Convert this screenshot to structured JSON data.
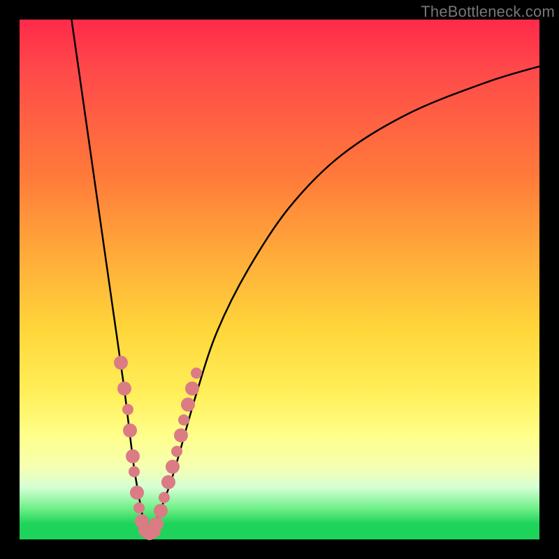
{
  "watermark": "TheBottleneck.com",
  "colors": {
    "border": "#000000",
    "curve": "#000000",
    "bead": "#db7b84",
    "gradient_top": "#ff2a4a",
    "gradient_mid": "#ffef5a",
    "gradient_bottom": "#1ed35a"
  },
  "plot": {
    "inner_size_px": 744,
    "border_px": 28
  },
  "chart_data": {
    "type": "line",
    "title": "",
    "xlabel": "",
    "ylabel": "",
    "xlim": [
      0,
      100
    ],
    "ylim": [
      0,
      100
    ],
    "series": [
      {
        "name": "bottleneck_curve",
        "x": [
          10,
          12,
          14,
          16,
          18,
          20,
          21,
          22,
          23,
          24,
          25,
          26,
          28,
          30,
          34,
          38,
          44,
          52,
          62,
          75,
          90,
          100
        ],
        "y": [
          100,
          86,
          72,
          58,
          44,
          30,
          22,
          14,
          8,
          3,
          1,
          3,
          8,
          14,
          28,
          40,
          52,
          64,
          74,
          82,
          88,
          91
        ]
      }
    ],
    "markers": {
      "name": "beads",
      "comment": "clustered points along lower curve near minimum",
      "points": [
        {
          "x": 19.5,
          "y": 34,
          "r": 10
        },
        {
          "x": 20.2,
          "y": 29,
          "r": 10
        },
        {
          "x": 20.8,
          "y": 25,
          "r": 8
        },
        {
          "x": 21.2,
          "y": 21,
          "r": 10
        },
        {
          "x": 21.8,
          "y": 16,
          "r": 10
        },
        {
          "x": 22.1,
          "y": 13,
          "r": 8
        },
        {
          "x": 22.6,
          "y": 9,
          "r": 10
        },
        {
          "x": 23.0,
          "y": 6,
          "r": 8
        },
        {
          "x": 23.5,
          "y": 3.5,
          "r": 10
        },
        {
          "x": 24.2,
          "y": 1.8,
          "r": 10
        },
        {
          "x": 25.0,
          "y": 1.2,
          "r": 10
        },
        {
          "x": 25.8,
          "y": 1.6,
          "r": 10
        },
        {
          "x": 26.4,
          "y": 3.0,
          "r": 10
        },
        {
          "x": 27.2,
          "y": 5.5,
          "r": 10
        },
        {
          "x": 27.8,
          "y": 8,
          "r": 8
        },
        {
          "x": 28.6,
          "y": 11,
          "r": 10
        },
        {
          "x": 29.4,
          "y": 14,
          "r": 10
        },
        {
          "x": 30.2,
          "y": 17,
          "r": 8
        },
        {
          "x": 31.0,
          "y": 20,
          "r": 10
        },
        {
          "x": 31.6,
          "y": 23,
          "r": 8
        },
        {
          "x": 32.4,
          "y": 26,
          "r": 10
        },
        {
          "x": 33.2,
          "y": 29,
          "r": 10
        },
        {
          "x": 34.0,
          "y": 32,
          "r": 8
        }
      ]
    }
  }
}
